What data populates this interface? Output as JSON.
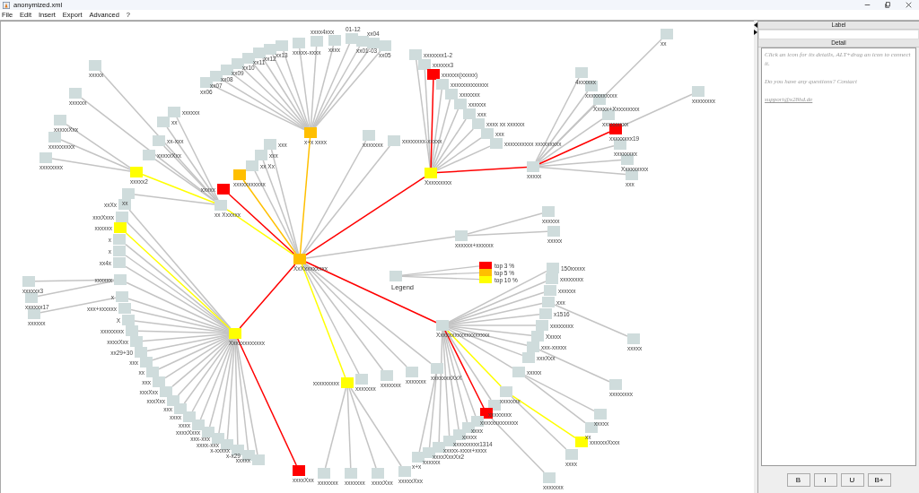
{
  "window": {
    "title": "anonymized.xml"
  },
  "menu": [
    "File",
    "Edit",
    "Insert",
    "Export",
    "Advanced",
    "?"
  ],
  "graph": {
    "root": {
      "label": "XxXxxxxxxxx",
      "color": "#ffbf00",
      "children": [
        {
          "label": "x+x xxxx",
          "color": "#ffbf00",
          "edge": {
            "color": "#ffbf00"
          },
          "children": [
            {
              "label": "xx06",
              "color": "#cfdcdc"
            },
            {
              "label": "xx07",
              "color": "#cfdcdc"
            },
            {
              "label": "xx08",
              "color": "#cfdcdc"
            },
            {
              "label": "xx09",
              "color": "#cfdcdc"
            },
            {
              "label": "xx10",
              "color": "#cfdcdc"
            },
            {
              "label": "xx11",
              "color": "#cfdcdc"
            },
            {
              "label": "xx12",
              "color": "#cfdcdc"
            },
            {
              "label": "xx13",
              "color": "#cfdcdc"
            },
            {
              "label": "xxxxx-xxxx",
              "color": "#cfdcdc"
            },
            {
              "label": "xxxx4xxx",
              "color": "#cfdcdc"
            },
            {
              "label": "xxxx",
              "color": "#cfdcdc"
            },
            {
              "label": "01-12",
              "color": "#cfdcdc"
            },
            {
              "label": "xx01-03",
              "color": "#cfdcdc"
            },
            {
              "label": "xx04",
              "color": "#cfdcdc"
            },
            {
              "label": "xx05",
              "color": "#cfdcdc"
            }
          ]
        },
        {
          "label": "xxxxxxx",
          "color": "#cfdcdc"
        },
        {
          "label": "xxxxxxxx-xxxxx",
          "color": "#cfdcdc"
        },
        {
          "label": "Xxxxxxxxx",
          "color": "#ffff00",
          "edge": {
            "color": "#ff0000"
          },
          "children": [
            {
              "label": "xxxxxxx1-2",
              "color": "#cfdcdc"
            },
            {
              "label": "xxxxxx3",
              "color": "#cfdcdc"
            },
            {
              "label": "xxxxxx(xxxxx)",
              "color": "#ff0000",
              "edge": {
                "color": "#ff0000"
              }
            },
            {
              "label": "xxxxxxxxxxxxx",
              "color": "#cfdcdc"
            },
            {
              "label": "xxxxxxx",
              "color": "#cfdcdc"
            },
            {
              "label": "xxxxxx",
              "color": "#cfdcdc"
            },
            {
              "label": "xxx",
              "color": "#cfdcdc"
            },
            {
              "label": "xxxx xx xxxxxx",
              "color": "#cfdcdc"
            },
            {
              "label": "xxx",
              "color": "#cfdcdc"
            },
            {
              "label": "xxxxxxxxxx xxxxxxxxx",
              "color": "#cfdcdc"
            },
            {
              "label": "xxxxx",
              "color": "#cfdcdc",
              "edge": {
                "color": "#ff0000"
              },
              "children": [
                {
                  "label": "xx",
                  "color": "#cfdcdc"
                },
                {
                  "label": "4xxxxxx",
                  "color": "#cfdcdc"
                },
                {
                  "label": "xxxxxxxxxxx",
                  "color": "#cfdcdc"
                },
                {
                  "label": "Xxxxx+Xxxxxxxxx",
                  "color": "#cfdcdc"
                },
                {
                  "label": "xxxxxxxxx",
                  "color": "#cfdcdc"
                },
                {
                  "label": "xxxxxxxx19",
                  "color": "#ff0000",
                  "edge": {
                    "color": "#ff0000"
                  },
                  "children": [
                    {
                      "label": "xxxxxxxx",
                      "color": "#cfdcdc"
                    }
                  ]
                },
                {
                  "label": "xxxxxxxx",
                  "color": "#cfdcdc"
                },
                {
                  "label": "Xxxxxxxxx",
                  "color": "#cfdcdc"
                },
                {
                  "label": "xxx",
                  "color": "#cfdcdc"
                }
              ]
            }
          ]
        },
        {
          "label": "xxxxxx+xxxxxx",
          "color": "#cfdcdc",
          "children": [
            {
              "label": "xxxxxx",
              "color": "#cfdcdc"
            },
            {
              "label": "xxxxx",
              "color": "#cfdcdc"
            }
          ]
        },
        {
          "label": "Xxxxxxxxxxxxxxxxxx",
          "color": "#cfdcdc",
          "edge": {
            "color": "#ff0000"
          },
          "children": [
            {
              "label": "150xxxxx",
              "color": "#cfdcdc"
            },
            {
              "label": "xxxxxxxx",
              "color": "#cfdcdc"
            },
            {
              "label": "xxxxxx",
              "color": "#cfdcdc"
            },
            {
              "label": "xxx",
              "color": "#cfdcdc",
              "children": [
                {
                  "label": "xxxxx",
                  "color": "#cfdcdc"
                }
              ]
            },
            {
              "label": "x1516",
              "color": "#cfdcdc"
            },
            {
              "label": "xxxxxxxx",
              "color": "#cfdcdc"
            },
            {
              "label": "Xxxxx",
              "color": "#cfdcdc"
            },
            {
              "label": "xxx-xxxxx",
              "color": "#cfdcdc",
              "children": [
                {
                  "label": "xxxxxxxx",
                  "color": "#cfdcdc"
                }
              ]
            },
            {
              "label": "xxxXxx",
              "color": "#cfdcdc"
            },
            {
              "label": "xxxxx",
              "color": "#cfdcdc",
              "children": [
                {
                  "label": "xxxxx",
                  "color": "#cfdcdc"
                },
                {
                  "label": "xx",
                  "color": "#cfdcdc"
                }
              ]
            },
            {
              "label": "xxxxxxx",
              "color": "#cfdcdc",
              "edge": {
                "color": "#ffff00"
              },
              "children": [
                {
                  "label": "xxxxxxXxxx",
                  "color": "#ffff00",
                  "edge": {
                    "color": "#ffff00"
                  }
                },
                {
                  "label": "xxxx",
                  "color": "#cfdcdc"
                }
              ]
            },
            {
              "label": "xxxxxxxx",
              "color": "#cfdcdc"
            },
            {
              "label": "xxxxxxxxxxxxx",
              "color": "#ff0000",
              "edge": {
                "color": "#ff0000"
              },
              "children": [
                {
                  "label": "xxxxxxx",
                  "color": "#cfdcdc"
                }
              ]
            },
            {
              "label": "xxxx",
              "color": "#cfdcdc"
            },
            {
              "label": "xxxxx",
              "color": "#cfdcdc"
            },
            {
              "label": "xxxxxxxxx1314",
              "color": "#cfdcdc"
            },
            {
              "label": "xxxxx-xxxx+xxxx",
              "color": "#cfdcdc"
            },
            {
              "label": "xxxxXxxXx2",
              "color": "#cfdcdc"
            }
          ]
        },
        {
          "label": "xxxxxxxxx",
          "color": "#ffff00",
          "edge": {
            "color": "#ffff00"
          },
          "children": [
            {
              "label": "xxxxxxx",
              "color": "#cfdcdc"
            },
            {
              "label": "xxxxxxx",
              "color": "#cfdcdc"
            },
            {
              "label": "xxxxXxx",
              "color": "#cfdcdc"
            },
            {
              "label": "xxxxxXxx",
              "color": "#cfdcdc"
            }
          ]
        },
        {
          "label": "xxxxxxx",
          "color": "#cfdcdc"
        },
        {
          "label": "xxxxxxx",
          "color": "#cfdcdc"
        },
        {
          "label": "xxxxxxx",
          "color": "#cfdcdc"
        },
        {
          "label": "xxxxxxxXxX",
          "color": "#cfdcdc",
          "children": [
            {
              "label": "xxxxxx",
              "color": "#cfdcdc"
            },
            {
              "label": "x+x",
              "color": "#cfdcdc"
            }
          ]
        },
        {
          "label": "Xxxxxxxxxxxx",
          "color": "#ffff00",
          "edge": {
            "color": "#ff0000"
          },
          "children": [
            {
              "label": "xxXx",
              "color": "#cfdcdc"
            },
            {
              "label": "xxxXxxx",
              "color": "#cfdcdc"
            },
            {
              "label": "xxxxxx",
              "color": "#ffff00",
              "edge": {
                "color": "#ffff00"
              }
            },
            {
              "label": "x",
              "color": "#cfdcdc"
            },
            {
              "label": "x",
              "color": "#cfdcdc"
            },
            {
              "label": "xx4x",
              "color": "#cfdcdc"
            },
            {
              "label": "xxxxxx",
              "color": "#cfdcdc",
              "children": [
                {
                  "label": "xxxxxx3",
                  "color": "#cfdcdc"
                },
                {
                  "label": "xxxxxx17",
                  "color": "#cfdcdc"
                }
              ]
            },
            {
              "label": "x",
              "color": "#cfdcdc",
              "children": [
                {
                  "label": "xxxxxx",
                  "color": "#cfdcdc"
                }
              ]
            },
            {
              "label": "xxx+xxxxxx",
              "color": "#cfdcdc"
            },
            {
              "label": "X",
              "color": "#cfdcdc"
            },
            {
              "label": "xxxxxxxx",
              "color": "#cfdcdc"
            },
            {
              "label": "xxxxXxx",
              "color": "#cfdcdc"
            },
            {
              "label": "xx29+30",
              "color": "#cfdcdc"
            },
            {
              "label": "xxx",
              "color": "#cfdcdc"
            },
            {
              "label": "xx",
              "color": "#cfdcdc"
            },
            {
              "label": "xxx",
              "color": "#cfdcdc"
            },
            {
              "label": "xxxXxx",
              "color": "#cfdcdc"
            },
            {
              "label": "xxxXxx",
              "color": "#cfdcdc"
            },
            {
              "label": "xxx",
              "color": "#cfdcdc"
            },
            {
              "label": "xxxx",
              "color": "#cfdcdc"
            },
            {
              "label": "xxxx",
              "color": "#cfdcdc"
            },
            {
              "label": "xxxxXxxx",
              "color": "#cfdcdc"
            },
            {
              "label": "xxx-xxx",
              "color": "#cfdcdc"
            },
            {
              "label": "xxxx-xxx",
              "color": "#cfdcdc"
            },
            {
              "label": "x-xxxxx",
              "color": "#cfdcdc"
            },
            {
              "label": "x-x29",
              "color": "#cfdcdc"
            },
            {
              "label": "xxxxx",
              "color": "#cfdcdc"
            },
            {
              "label": "xxxxXxx",
              "color": "#ff0000",
              "edge": {
                "color": "#ff0000"
              }
            }
          ]
        },
        {
          "label": "xx Xxxxxx",
          "color": "#cfdcdc",
          "edge": {
            "color": "#ffff00"
          },
          "children": [
            {
              "label": "xx",
              "color": "#cfdcdc"
            },
            {
              "label": "xxxxx2",
              "color": "#ffff00",
              "edge": {
                "color": "#ffff00"
              },
              "children": [
                {
                  "label": "xxxxxXxx",
                  "color": "#cfdcdc"
                },
                {
                  "label": "xxxxxxxxx",
                  "color": "#cfdcdc"
                },
                {
                  "label": "xxxxxxxx",
                  "color": "#cfdcdc"
                }
              ]
            },
            {
              "label": "xx-xxx",
              "color": "#cfdcdc"
            },
            {
              "label": "xxxxxXxx",
              "color": "#cfdcdc"
            },
            {
              "label": "xx",
              "color": "#cfdcdc"
            },
            {
              "label": "xxxxxx",
              "color": "#cfdcdc"
            },
            {
              "label": "xxxxx",
              "color": "#cfdcdc"
            },
            {
              "label": "xxxxxx",
              "color": "#cfdcdc"
            }
          ]
        },
        {
          "label": "xxxxxxxxxxx",
          "color": "#ffbf00",
          "edge": {
            "color": "#ffbf00"
          }
        },
        {
          "label": "xx Xx",
          "color": "#cfdcdc"
        },
        {
          "label": "xxx",
          "color": "#cfdcdc"
        },
        {
          "label": "xxx",
          "color": "#cfdcdc"
        },
        {
          "label": "xxxxx",
          "color": "#ff0000",
          "edge": {
            "color": "#ff0000"
          }
        }
      ]
    }
  },
  "legend": {
    "label": "Legend",
    "items": [
      {
        "label": "top 3 %",
        "color": "#ff0000"
      },
      {
        "label": "top 5 %",
        "color": "#ffbf00"
      },
      {
        "label": "top 10 %",
        "color": "#ffff00"
      }
    ]
  },
  "panel": {
    "label_heading": "Label",
    "detail_heading": "Detail",
    "detail_text": "Click an icon for its details, ALT+drag an icon to connect it.",
    "question": "Do you have any questions? Contact",
    "link": "support@x28hd.de",
    "buttons": [
      "B",
      "I",
      "U",
      "B+"
    ]
  }
}
